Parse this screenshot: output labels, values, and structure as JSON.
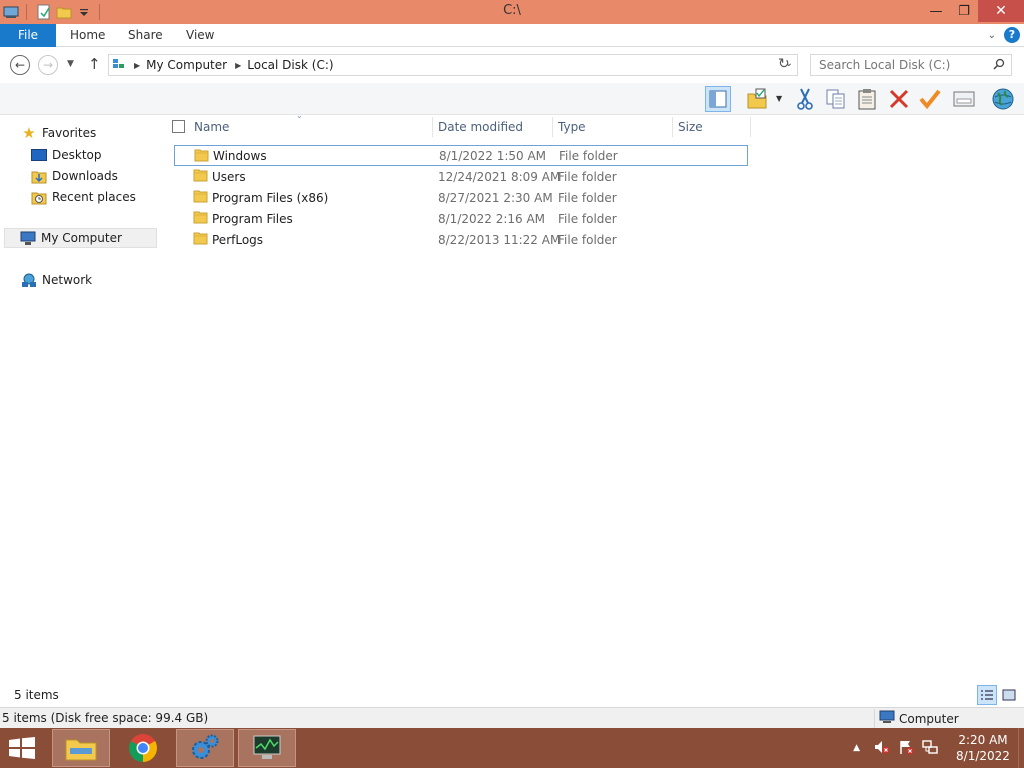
{
  "window": {
    "title": "C:\\"
  },
  "ribbon": {
    "tabs": [
      "File",
      "Home",
      "Share",
      "View"
    ]
  },
  "address": {
    "crumbs": [
      "My Computer",
      "Local Disk (C:)"
    ]
  },
  "search": {
    "placeholder": "Search Local Disk (C:)"
  },
  "navpane": {
    "favorites_label": "Favorites",
    "favorites": [
      "Desktop",
      "Downloads",
      "Recent places"
    ],
    "computer": "My Computer",
    "network": "Network"
  },
  "list": {
    "columns": [
      "Name",
      "Date modified",
      "Type",
      "Size"
    ],
    "rows": [
      {
        "name": "Windows",
        "date": "8/1/2022 1:50 AM",
        "type": "File folder"
      },
      {
        "name": "Users",
        "date": "12/24/2021 8:09 AM",
        "type": "File folder"
      },
      {
        "name": "Program Files (x86)",
        "date": "8/27/2021 2:30 AM",
        "type": "File folder"
      },
      {
        "name": "Program Files",
        "date": "8/1/2022 2:16 AM",
        "type": "File folder"
      },
      {
        "name": "PerfLogs",
        "date": "8/22/2013 11:22 AM",
        "type": "File folder"
      }
    ]
  },
  "status": {
    "count": "5 items",
    "detail": "5 items (Disk free space: 99.4 GB)",
    "location": "Computer"
  },
  "taskbar": {
    "time": "2:20 AM",
    "date": "8/1/2022"
  },
  "colors": {
    "titlebar": "#e8896a",
    "accent": "#1979ca",
    "taskbar": "#8a4d38",
    "close": "#c7504a"
  }
}
